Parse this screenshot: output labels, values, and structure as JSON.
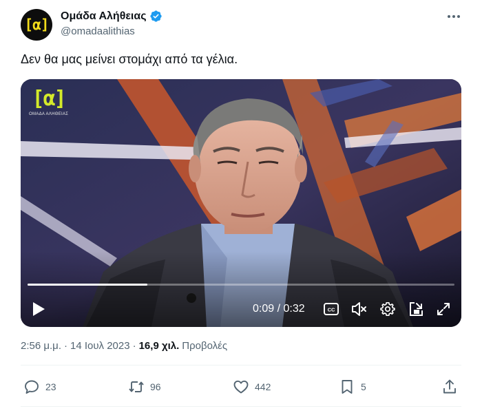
{
  "user": {
    "display_name": "Ομάδα Αλήθειας",
    "handle": "@omadaalithias",
    "avatar_mark": "[α]",
    "verified": true,
    "verified_color": "#1d9bf0"
  },
  "tweet": {
    "text": "Δεν θα μας μείνει στομάχι από τα γέλια."
  },
  "media": {
    "channel_logo_mark": "[α]",
    "channel_logo_name": "ΟΜΑΔΑ ΑΛΗΘΕΙΑΣ",
    "current_time": "0:09",
    "duration": "0:32",
    "time_display": "0:09 / 0:32",
    "progress_percent": 28,
    "icons": [
      "play-icon",
      "closed-captions-icon",
      "volume-muted-icon",
      "settings-gear-icon",
      "picture-in-picture-icon",
      "fullscreen-icon"
    ]
  },
  "meta": {
    "time": "2:56 μ.μ.",
    "date": "14 Ιουλ 2023",
    "separator": "·",
    "views_count": "16,9 χιλ.",
    "views_label": "Προβολές"
  },
  "actions": {
    "replies": "23",
    "retweets": "96",
    "likes": "442",
    "bookmarks": "5"
  },
  "colors": {
    "text_primary": "#0f1419",
    "text_secondary": "#536471",
    "divider": "#eff3f4",
    "brand_yellow": "#f2dc1b"
  }
}
